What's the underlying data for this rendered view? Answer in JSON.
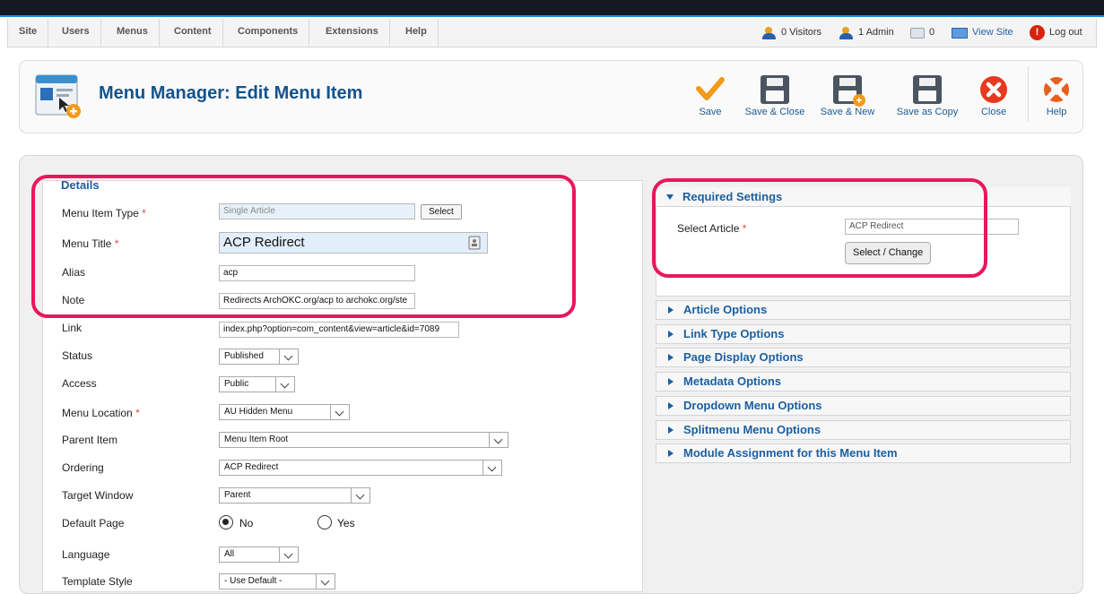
{
  "menubar": {
    "items": [
      "Site",
      "Users",
      "Menus",
      "Content",
      "Components",
      "Extensions",
      "Help"
    ]
  },
  "status": {
    "visitors": "0 Visitors",
    "admin": "1 Admin",
    "messages": "0",
    "view_site": "View Site",
    "logout": "Log out"
  },
  "header": {
    "title": "Menu Manager: Edit Menu Item"
  },
  "toolbar": {
    "save": "Save",
    "save_close": "Save & Close",
    "save_new": "Save & New",
    "save_copy": "Save as Copy",
    "close": "Close",
    "help": "Help"
  },
  "details": {
    "legend": "Details",
    "menu_item_type": {
      "label": "Menu Item Type",
      "value": "Single Article",
      "button": "Select"
    },
    "menu_title": {
      "label": "Menu Title",
      "value": "ACP Redirect"
    },
    "alias": {
      "label": "Alias",
      "value": "acp"
    },
    "note": {
      "label": "Note",
      "value": "Redirects ArchOKC.org/acp to archokc.org/ste"
    },
    "link": {
      "label": "Link",
      "value": "index.php?option=com_content&view=article&id=7089"
    },
    "status": {
      "label": "Status",
      "value": "Published"
    },
    "access": {
      "label": "Access",
      "value": "Public"
    },
    "menu_location": {
      "label": "Menu Location",
      "value": "AU Hidden Menu"
    },
    "parent_item": {
      "label": "Parent Item",
      "value": "Menu Item Root"
    },
    "ordering": {
      "label": "Ordering",
      "value": "ACP Redirect"
    },
    "target_window": {
      "label": "Target Window",
      "value": "Parent"
    },
    "default_page": {
      "label": "Default Page",
      "no": "No",
      "yes": "Yes"
    },
    "language": {
      "label": "Language",
      "value": "All"
    },
    "template_style": {
      "label": "Template Style",
      "value": "- Use Default -"
    }
  },
  "required": {
    "title": "Required Settings",
    "select_article_label": "Select Article",
    "article_value": "ACP Redirect",
    "button": "Select / Change"
  },
  "sections": [
    "Article Options",
    "Link Type Options",
    "Page Display Options",
    "Metadata Options",
    "Dropdown Menu Options",
    "Splitmenu Menu Options",
    "Module Assignment for this Menu Item"
  ],
  "colors": {
    "accent": "#1c5fa0",
    "highlight": "#e8175d"
  }
}
